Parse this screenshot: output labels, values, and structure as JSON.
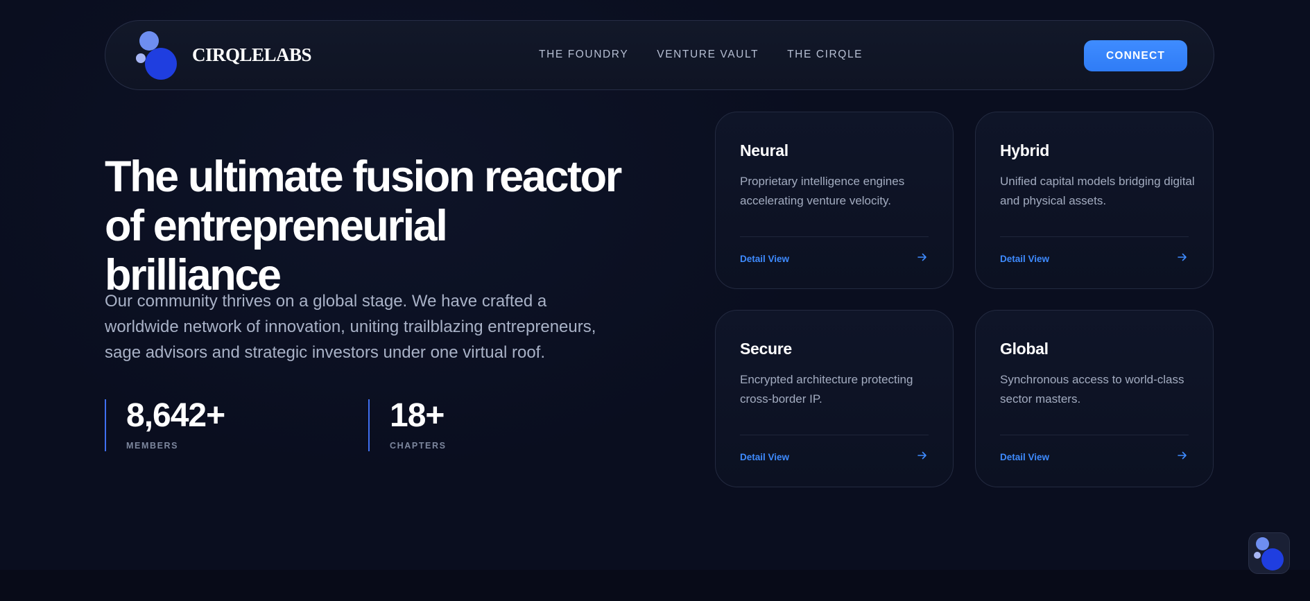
{
  "brand": {
    "name": "CIRQLELABS"
  },
  "nav": {
    "links": [
      "THE FOUNDRY",
      "VENTURE VAULT",
      "THE CIRQLE"
    ],
    "cta": "CONNECT"
  },
  "hero": {
    "title_line1": "The ultimate fusion reactor",
    "title_line2": "of entrepreneurial brilliance",
    "description": "Our community thrives on a global stage. We have crafted a worldwide network of innovation, uniting trailblazing entrepreneurs, sage advisors and strategic investors under one virtual roof."
  },
  "stats": [
    {
      "value": "8,642+",
      "label": "MEMBERS"
    },
    {
      "value": "18+",
      "label": "CHAPTERS"
    }
  ],
  "cards": [
    {
      "title": "Neural",
      "description": "Proprietary intelligence engines accelerating venture velocity.",
      "link": "Detail View"
    },
    {
      "title": "Hybrid",
      "description": "Unified capital models bridging digital and physical assets.",
      "link": "Detail View"
    },
    {
      "title": "Secure",
      "description": "Encrypted architecture protecting cross-border IP.",
      "link": "Detail View"
    },
    {
      "title": "Global",
      "description": "Synchronous access to world-class sector masters.",
      "link": "Detail View"
    }
  ],
  "colors": {
    "background": "#0a0e1f",
    "accent": "#3e8bff",
    "logo_primary": "#1f3ee0",
    "logo_secondary": "#6e8ef0"
  },
  "icons": {
    "card_arrow": "arrow-right-icon",
    "logo": "cirqle-logo-icon",
    "widget": "cirqle-widget-icon"
  }
}
